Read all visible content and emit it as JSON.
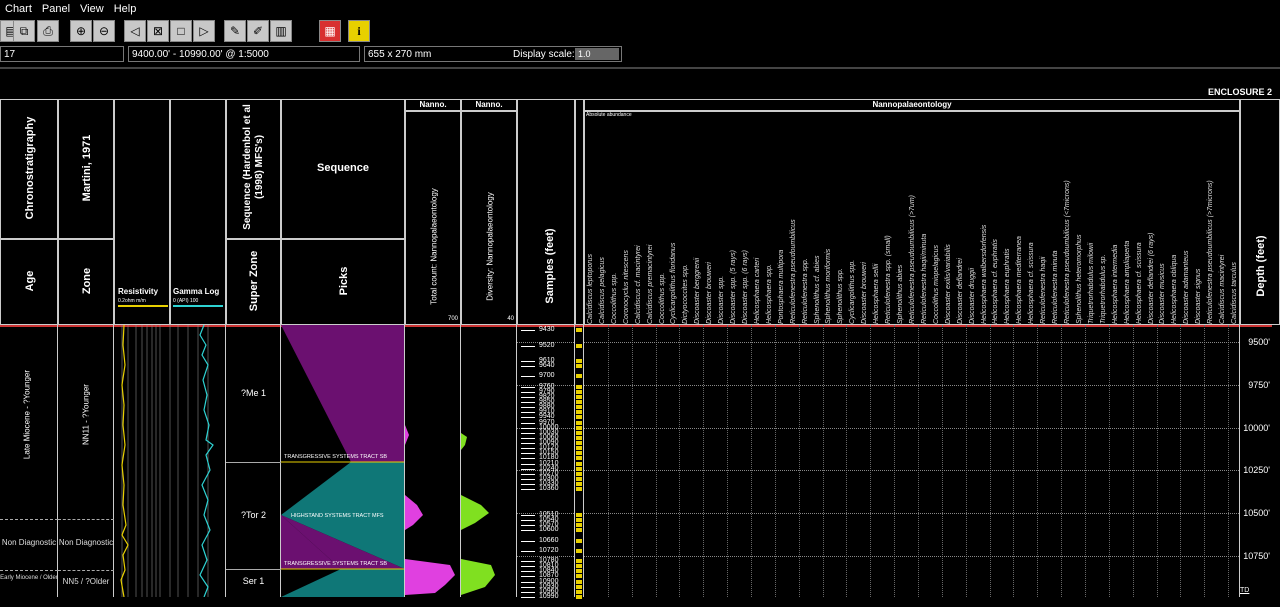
{
  "menu": [
    "Chart",
    "Panel",
    "View",
    "Help"
  ],
  "toolbar": {
    "info_glyph": "i",
    "icons": [
      "open-icon",
      "copy-icon",
      "print-icon",
      "zoom-in-icon",
      "zoom-out-icon",
      "prev-icon",
      "fit-icon",
      "frame-icon",
      "next-icon",
      "pencil-icon",
      "edit-icon",
      "columns-icon",
      "pattern-icon",
      "info-icon"
    ]
  },
  "status": {
    "field1": "17",
    "range": "9400.00' - 10990.00' @ 1:5000",
    "size": "655 x 270 mm",
    "display_scale_label": "Display scale:",
    "display_scale_value": "1.0"
  },
  "enclosure": "ENCLOSURE 2",
  "headers": {
    "chronostratigraphy": "Chronostratigraphy",
    "martini": "Martini, 1971",
    "age": "Age",
    "zone": "Zone",
    "resistivity": "Resistivity",
    "resistivity_scale": "0.2ohm m/m",
    "gamma": "Gamma Log",
    "gamma_scale": "0     (API)     100",
    "sequence_hardenbol": "Sequence (Hardenbol et al (1998) MFS's)",
    "sequence": "Sequence",
    "super_zone": "Super Zone",
    "picks": "Picks",
    "nanno1": "Nanno.",
    "nanno2": "Nanno.",
    "total_count": "Total count: Nannopalaeontology",
    "total_scale": "700",
    "diversity": "Diversity: Nannopalaeontology",
    "diversity_scale": "40",
    "samples": "Samples (feet)",
    "nannopal": "Nannopalaeontology",
    "absolute": "Absolute abundance",
    "depth": "Depth (feet)"
  },
  "ages": [
    {
      "label": "Late Miocene - ?Younger"
    },
    {
      "label": "Non Diagnostic"
    },
    {
      "label": "Early Miocene / Older"
    }
  ],
  "zones": [
    {
      "label": "NN11 - ?Younger"
    },
    {
      "label": "Non Diagnostic"
    },
    {
      "label": "NN5 / ?Older"
    }
  ],
  "super_zones": [
    "?Me 1",
    "?Tor 2",
    "Ser 1"
  ],
  "picks": [
    "TRANSGRESSIVE SYSTEMS TRACT SB",
    "HIGHSTAND SYSTEMS TRACT MFS",
    "TRANSGRESSIVE SYSTEMS TRACT SB"
  ],
  "depth_ticks": [
    "9500'",
    "9750'",
    "10000'",
    "10250'",
    "10500'",
    "10750'"
  ],
  "td_label": "TD",
  "samples": [
    "9430",
    "9520",
    "9610",
    "9640",
    "9700",
    "9760",
    "9790",
    "9820",
    "9850",
    "9880",
    "9910",
    "9940",
    "9970",
    "10000",
    "10030",
    "10060",
    "10090",
    "10120",
    "10150",
    "10180",
    "10210",
    "10240",
    "10270",
    "10300",
    "10330",
    "10360",
    "10510",
    "10540",
    "10570",
    "10600",
    "10660",
    "10720",
    "10780",
    "10810",
    "10840",
    "10870",
    "10900",
    "10930",
    "10960",
    "10990"
  ],
  "species": [
    "Calcidiscus leptoporus",
    "Calcidiscus pelagicus",
    "Coccolithus spp.",
    "Coronocyclus nitescens",
    "Calcidiscus cf. macintyrei",
    "Calcidiscus premacintyrei",
    "Coccolithus spp.",
    "Cyclicargolithus floridanus",
    "Dictyococcites spp.",
    "Discoaster berggrenii",
    "Discoaster brouweri",
    "Discoaster spp.",
    "Discoaster spp. (5 rays)",
    "Discoaster spp. (6 rays)",
    "Helicosphaera carteri",
    "Helicosphaera spp.",
    "Pontosphaera multipora",
    "Reticulofenestra pseudoumbilicus",
    "Reticulofenestra spp.",
    "Sphenolithus cf. abies",
    "Sphenolithus moriformis",
    "Sphenolithus spp.",
    "Cyclicargolithus spp.",
    "Discoaster brouweri",
    "Helicosphaera sellii",
    "Reticulofenestra spp. (small)",
    "Sphenolithus abies",
    "Reticulofenestra pseudoumbilicus (>7um)",
    "Reticulofenestra haqii/minuta",
    "Coccolithus miopelagicus",
    "Discoaster exilis/variabilis",
    "Discoaster deflandrei",
    "Discoaster druggii",
    "Helicosphaera walbersdorfensis",
    "Helicosphaera cf. euphratis",
    "Helicosphaera euphratis",
    "Helicosphaera mediterranea",
    "Helicosphaera cf. scissura",
    "Reticulofenestra haqii",
    "Reticulofenestra minuta",
    "Reticulofenestra pseudoumbilicus (<7microns)",
    "Sphenolithus heteromorphus",
    "Triquetrorhabdulus milowii",
    "Triquetrorhabdulus sp.",
    "Helicosphaera intermedia",
    "Helicosphaera ampliaperta",
    "Helicosphaera cf. scissura",
    "Discoaster deflandrei (6 rays)",
    "Discoaster musicus",
    "Helicosphaera obliqua",
    "Discoaster adamanteus",
    "Discoaster signus",
    "Reticulofenestra pseudoumbilicus (>7microns)",
    "Calcidiscus macintyrei",
    "Calcidiscus tarculus"
  ],
  "colors": {
    "purple": "#6b1070",
    "teal": "#0f7777",
    "magenta": "#e040e0",
    "green": "#80e020",
    "yellow": "#e8d000",
    "cyan": "#2ed3d3"
  }
}
